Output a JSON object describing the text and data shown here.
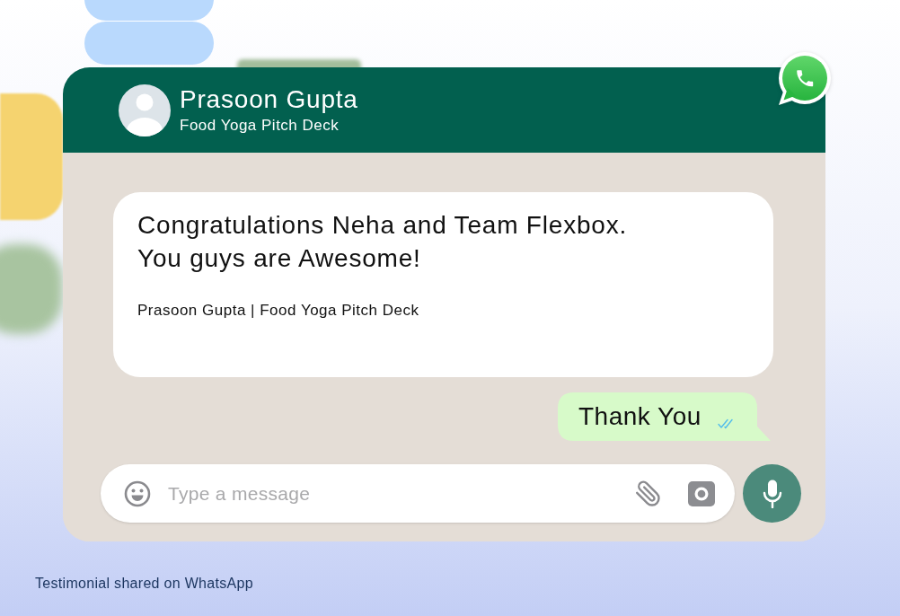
{
  "chat_header": {
    "name": "Prasoon Gupta",
    "subtitle": "Food Yoga Pitch Deck"
  },
  "messages": [
    {
      "kind": "incoming",
      "lines": [
        "Congratulations Neha and Team Flexbox.",
        "You guys are Awesome!"
      ],
      "signature": "Prasoon Gupta | Food Yoga Pitch Deck"
    },
    {
      "kind": "outgoing",
      "text": "Thank You",
      "read": true
    }
  ],
  "composer": {
    "placeholder": "Type a message"
  },
  "caption": "Testimonial shared on WhatsApp"
}
